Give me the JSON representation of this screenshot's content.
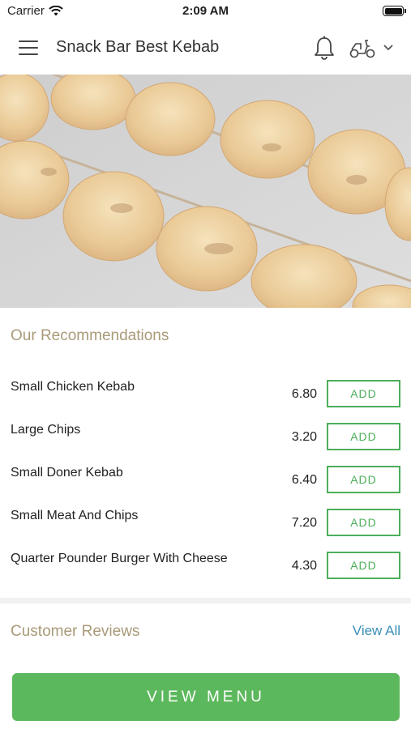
{
  "status_bar": {
    "carrier": "Carrier",
    "time": "2:09 AM"
  },
  "header": {
    "title": "Snack Bar Best Kebab"
  },
  "recommendations": {
    "title": "Our Recommendations",
    "items": [
      {
        "name": "Small Chicken Kebab",
        "price": "6.80",
        "action": "ADD"
      },
      {
        "name": "Large Chips",
        "price": "3.20",
        "action": "ADD"
      },
      {
        "name": "Small Doner Kebab",
        "price": "6.40",
        "action": "ADD"
      },
      {
        "name": "Small Meat And Chips",
        "price": "7.20",
        "action": "ADD"
      },
      {
        "name": "Quarter Pounder Burger With Cheese",
        "price": "4.30",
        "action": "ADD"
      }
    ]
  },
  "reviews": {
    "title": "Customer Reviews",
    "view_all": "View All"
  },
  "footer": {
    "button_label": "VIEW MENU"
  },
  "colors": {
    "accent_green": "#5cb85c",
    "section_title": "#a99a78",
    "link_blue": "#3a8fb7"
  }
}
